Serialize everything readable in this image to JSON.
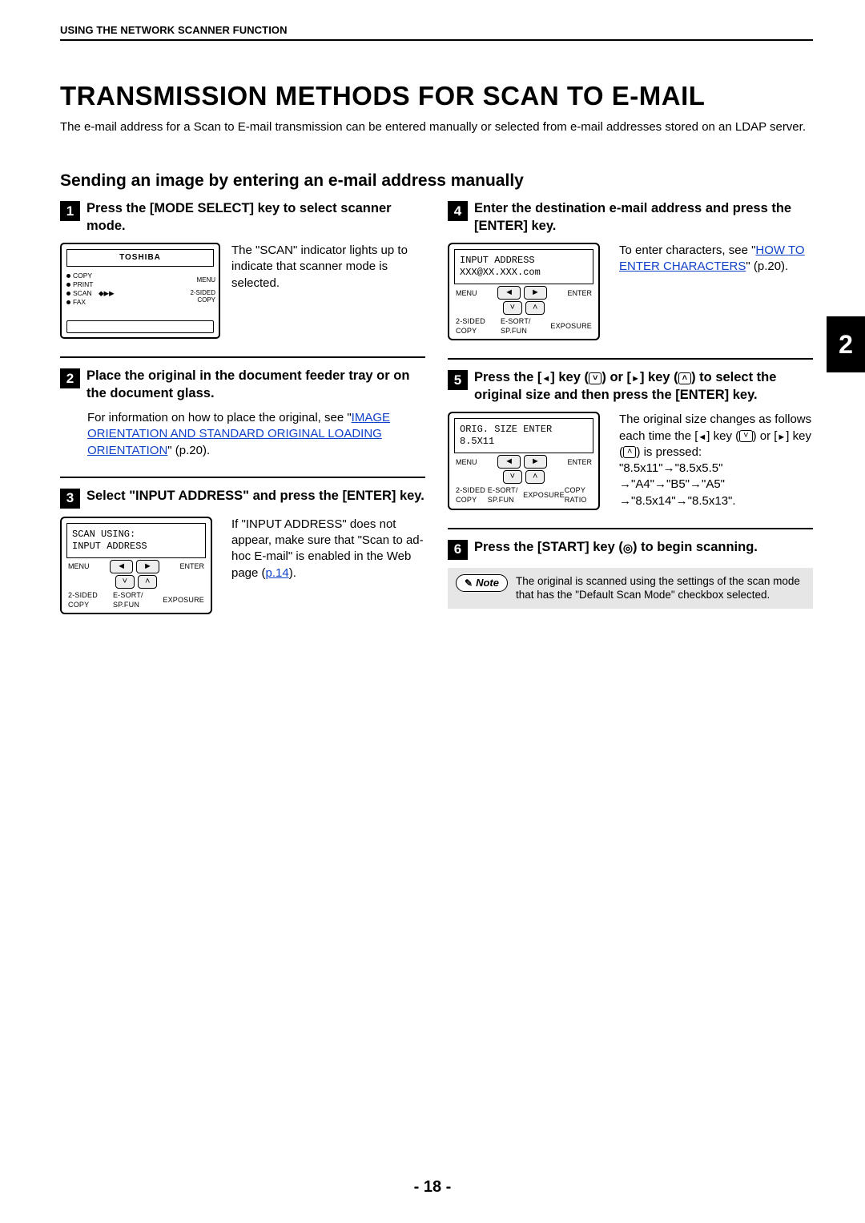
{
  "header": {
    "running_head": "USING THE NETWORK SCANNER FUNCTION"
  },
  "chapter_tab": "2",
  "title": "TRANSMISSION METHODS FOR SCAN TO E-MAIL",
  "intro": "The e-mail address for a Scan to E-mail transmission can be entered manually or selected from e-mail addresses stored on an LDAP server.",
  "subtitle": "Sending an image by entering an e-mail address manually",
  "steps": {
    "s1": {
      "num": "1",
      "head": "Press the [MODE SELECT] key to select scanner mode.",
      "body": "The \"SCAN\" indicator lights up to indicate that scanner mode is selected.",
      "panel": {
        "brand": "TOSHIBA",
        "modes": [
          "COPY",
          "PRINT",
          "SCAN",
          "FAX"
        ],
        "scan_marker": "◆▶▶",
        "right": [
          "MENU",
          "2-SIDED",
          "COPY"
        ]
      }
    },
    "s2": {
      "num": "2",
      "head": "Place the original in the document feeder tray or on the document glass.",
      "body_pre": "For information on how to place the original, see \"",
      "link": "IMAGE ORIENTATION AND STANDARD ORIGINAL LOADING ORIENTATION",
      "body_post": "\" (p.20)."
    },
    "s3": {
      "num": "3",
      "head": "Select \"INPUT ADDRESS\" and press the [ENTER] key.",
      "lcd": {
        "line1": "SCAN USING:",
        "line2": "INPUT ADDRESS",
        "row1": {
          "left": "MENU",
          "right": "ENTER"
        },
        "row2": {
          "a": "2-SIDED COPY",
          "b": "E-SORT/ SP.FUN",
          "c": "EXPOSURE",
          "d": ""
        }
      },
      "body_pre": "If \"INPUT ADDRESS\" does not appear, make sure that \"Scan to ad-hoc E-mail\" is enabled in the Web page (",
      "link": "p.14",
      "body_post": ")."
    },
    "s4": {
      "num": "4",
      "head": "Enter the destination e-mail address and press the [ENTER] key.",
      "lcd": {
        "line1": "INPUT ADDRESS",
        "line2": "XXX@XX.XXX.com",
        "row1": {
          "left": "MENU",
          "right": "ENTER"
        },
        "row2": {
          "a": "2-SIDED COPY",
          "b": "E-SORT/ SP.FUN",
          "c": "EXPOSURE",
          "d": ""
        }
      },
      "body_pre": "To enter characters, see \"",
      "link": "HOW TO ENTER CHARACTERS",
      "body_post": "\" (p.20)."
    },
    "s5": {
      "num": "5",
      "head_pre": "Press the [",
      "head_mid1": "] key (",
      "head_mid2": ") or [",
      "head_mid3": "] key (",
      "head_mid4": ") to select the original size and then press the [ENTER] key.",
      "lcd": {
        "line1": "ORIG. SIZE ENTER",
        "line2": "8.5X11",
        "row1": {
          "left": "MENU",
          "right": "ENTER"
        },
        "row2": {
          "a": "2-SIDED COPY",
          "b": "E-SORT/ SP.FUN",
          "c": "EXPOSURE",
          "d": "COPY RATIO"
        }
      },
      "body_pre": "The original size changes as follows each time the [",
      "body_mid1": "] key (",
      "body_mid2": ") or [",
      "body_mid3": "] key (",
      "body_mid4": ") is pressed:",
      "seq": "\"8.5x11\"→\"8.5x5.5\" →\"A4\"→\"B5\"→\"A5\" →\"8.5x14\"→\"8.5x13\"."
    },
    "s6": {
      "num": "6",
      "head_pre": "Press the [START] key (",
      "head_post": ") to begin scanning.",
      "note_label": "Note",
      "note_body": "The original is scanned using the settings of the scan mode that has the \"Default Scan Mode\" checkbox selected."
    }
  },
  "page_number": "- 18 -"
}
